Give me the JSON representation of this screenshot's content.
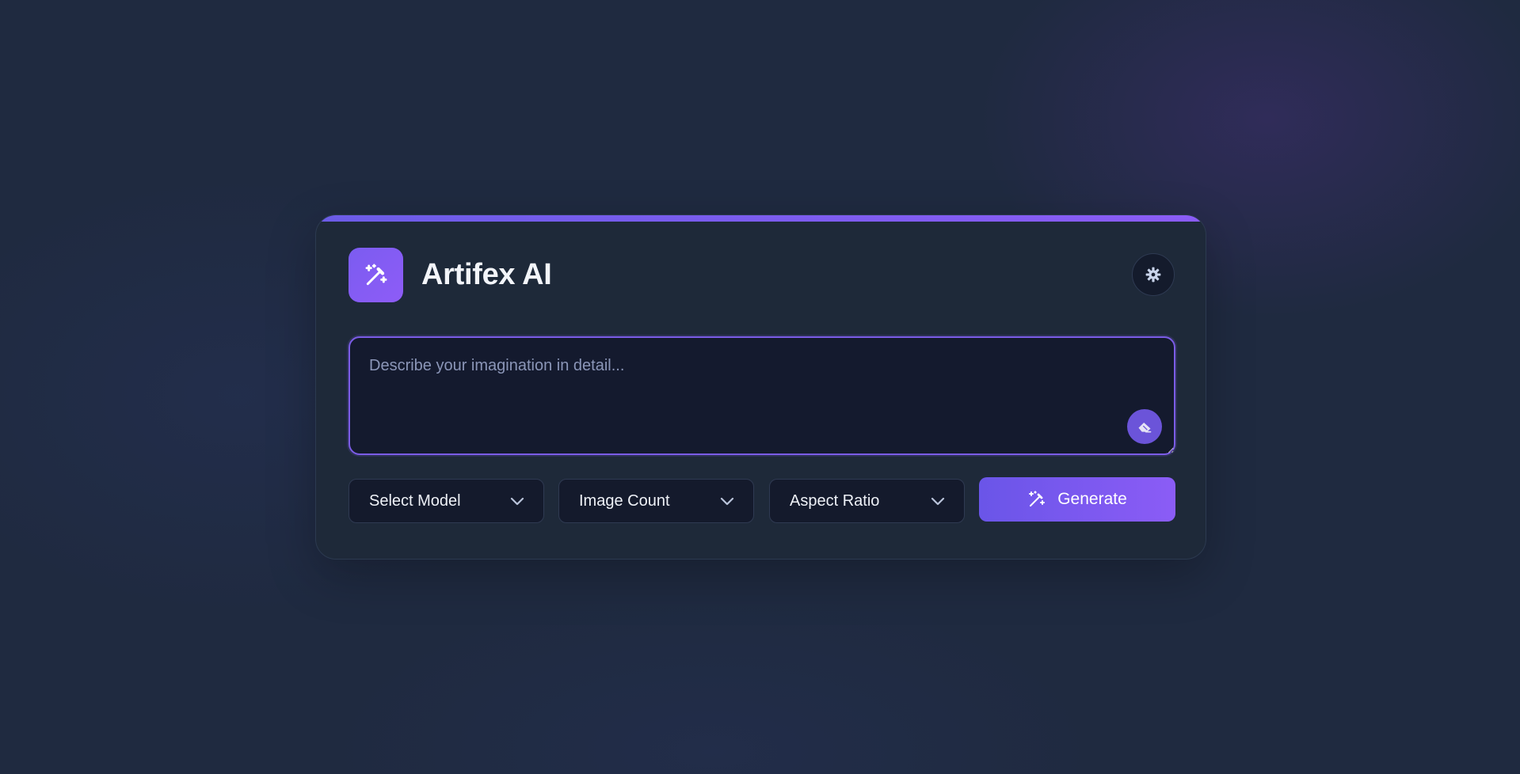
{
  "app": {
    "title": "Artifex AI",
    "logo_icon": "magic-wand-sparkles-icon"
  },
  "header": {
    "settings_icon": "gear-icon"
  },
  "prompt": {
    "value": "",
    "placeholder": "Describe your imagination in detail...",
    "clear_icon": "eraser-icon"
  },
  "controls": {
    "model_select": {
      "label": "Select Model",
      "icon": "chevron-down-icon"
    },
    "count_select": {
      "label": "Image Count",
      "icon": "chevron-down-icon"
    },
    "ratio_select": {
      "label": "Aspect Ratio",
      "icon": "chevron-down-icon"
    },
    "generate": {
      "label": "Generate",
      "icon": "magic-wand-sparkles-icon"
    }
  },
  "colors": {
    "accent": "#7c5cf0",
    "card_bg": "#1e2939",
    "page_bg": "#1f2a40",
    "input_bg": "#141a2e"
  }
}
